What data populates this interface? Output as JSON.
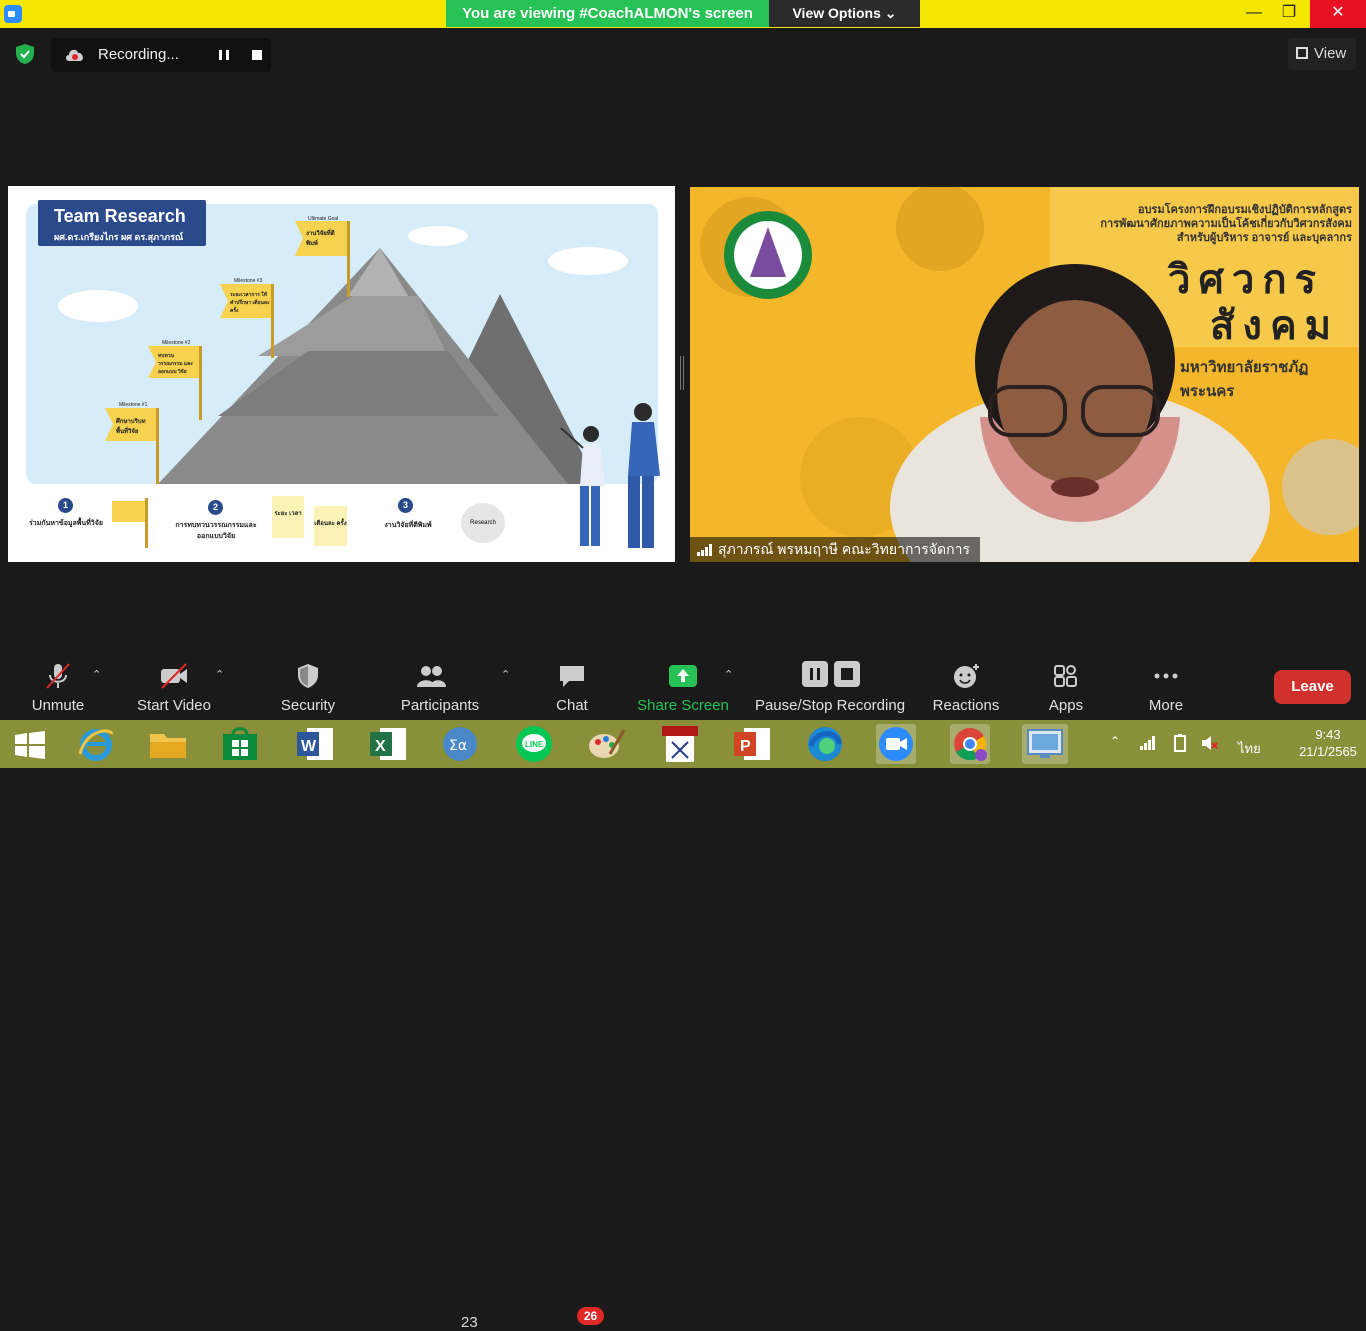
{
  "titlebar": {
    "banner_text": "You are viewing #CoachALMON's screen",
    "view_options": "View Options ⌄",
    "minimize": "—",
    "maximize": "❐",
    "close": "✕"
  },
  "recording": {
    "label": "Recording..."
  },
  "top_right": {
    "view_label": "View"
  },
  "slide": {
    "title": "Team Research",
    "subtitle": "ผศ.ดร.เกรียงไกร ผศ ดร.สุภาภรณ์",
    "ultimate_goal": "Ultimate Goal",
    "ultimate_flag": "งานวิจัยที่ตีพิมพ์",
    "milestone3": "Milestone #3",
    "milestone3_flag": "ระยะเวลาการ ให้คำปรึกษา เดือนละครั้ง",
    "milestone2": "Milestone #2",
    "milestone2_flag": "ทบทวน วรรณกรรม และออกแบบ วิจัย",
    "milestone1": "Milestone #1",
    "milestone1_flag": "ศึกษาบริบท พื้นที่วิจัย",
    "step1_num": "1",
    "step1_text": "ร่วมกันหาข้อมูลพื้นที่วิจัย",
    "step2_num": "2",
    "step2_text": "การทบทวนวรรณกรรมและออกแบบวิจัย",
    "sticky1": "ระยะ เวลา",
    "sticky2": "เดือนละ ครั้ง",
    "step3_num": "3",
    "step3_text": "งานวิจัยที่ตีพิมพ์",
    "research_bubble": "Research"
  },
  "participant_video": {
    "name": "สุภาภรณ์ พรหมฤาษี คณะวิทยาการจัดการ",
    "bg_heading_1": "อบรมโครงการฝึกอบรมเชิงปฏิบัติการหลักสูตร",
    "bg_heading_2": "การพัฒนาศักยภาพความเป็นโค้ชเกี่ยวกับวิศวกรสังคม",
    "bg_heading_3": "สำหรับผู้บริหาร อาจารย์ และบุคลากร",
    "bg_big_1": "วิศวกร",
    "bg_big_2": "สังคม",
    "bg_university": "มหาวิทยาลัยราชภัฏพระนคร"
  },
  "toolbar": {
    "unmute": "Unmute",
    "start_video": "Start Video",
    "security": "Security",
    "participants": "Participants",
    "participants_count": "23",
    "chat": "Chat",
    "chat_badge": "26",
    "share_screen": "Share Screen",
    "pause_stop_recording": "Pause/Stop Recording",
    "reactions": "Reactions",
    "apps": "Apps",
    "more": "More",
    "leave": "Leave"
  },
  "taskbar": {
    "language": "ไทย",
    "time": "9:43",
    "date": "21/1/2565"
  },
  "colors": {
    "titlebar_yellow": "#f5e600",
    "banner_green": "#27c255",
    "share_green": "#27c255",
    "leave_red": "#d0312d",
    "badge_red": "#e02828",
    "taskbar_olive": "#8a8f3a"
  }
}
